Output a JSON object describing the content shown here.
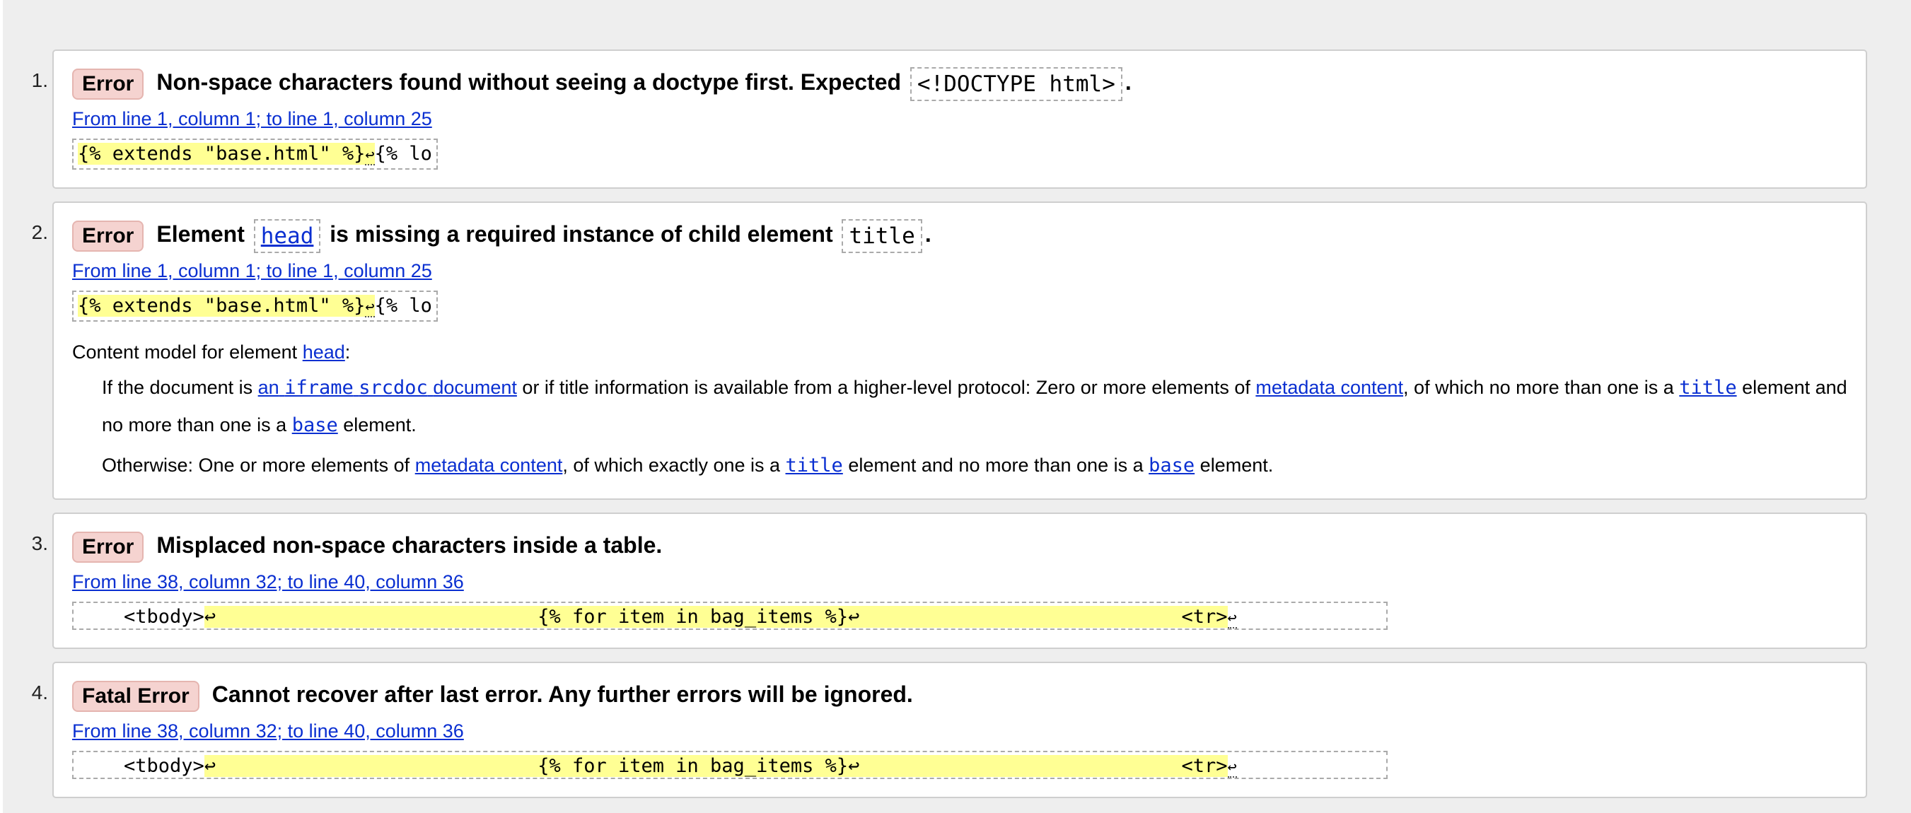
{
  "messages": [
    {
      "number": "1.",
      "badge": "Error",
      "text_a": "Non-space characters found without seeing a doctype first. Expected",
      "code": "<!DOCTYPE html>",
      "text_b": ".",
      "location": "From line 1, column 1; to line 1, column 25",
      "extract_mark": "{% extends \"base.html\" %}",
      "extract_lf": "↩",
      "extract_rest": "{% lo"
    },
    {
      "number": "2.",
      "badge": "Error",
      "text_a": "Element",
      "code_link": "head",
      "text_b": "is missing a required instance of child element",
      "code": "title",
      "text_c": ".",
      "location": "From line 1, column 1; to line 1, column 25",
      "extract_mark": "{% extends \"base.html\" %}",
      "extract_lf": "↩",
      "extract_rest": "{% lo",
      "content_model_label": "Content model for element",
      "content_model_link": "head",
      "content_model_colon": ":",
      "p1_a": "If the document is",
      "p1_link_a": "an",
      "p1_link_code1": "iframe",
      "p1_link_code2": "srcdoc",
      "p1_link_b": "document",
      "p1_b": "or if title information is available from a higher-level protocol: Zero or more elements of",
      "p1_link_metadata": "metadata content",
      "p1_c": ", of which no more than one is a",
      "p1_link_title": "title",
      "p1_d": "element and no more than one is a",
      "p1_link_base": "base",
      "p1_e": "element.",
      "p2_a": "Otherwise: One or more elements of",
      "p2_link_metadata": "metadata content",
      "p2_b": ", of which exactly one is a",
      "p2_link_title": "title",
      "p2_c": "element and no more than one is a",
      "p2_link_base": "base",
      "p2_d": "element."
    },
    {
      "number": "3.",
      "badge": "Error",
      "text_a": "Misplaced non-space characters inside a table.",
      "location": "From line 38, column 32; to line 40, column 36",
      "extract_pre": "    <tbody>",
      "extract_mark": "↩                            {% for item in bag_items %}↩                            <tr>",
      "extract_lf": "↩"
    },
    {
      "number": "4.",
      "badge": "Fatal Error",
      "text_a": "Cannot recover after last error. Any further errors will be ignored.",
      "location": "From line 38, column 32; to line 40, column 36",
      "extract_pre": "    <tbody>",
      "extract_mark": "↩                            {% for item in bag_items %}↩                            <tr>",
      "extract_lf": "↩"
    }
  ]
}
